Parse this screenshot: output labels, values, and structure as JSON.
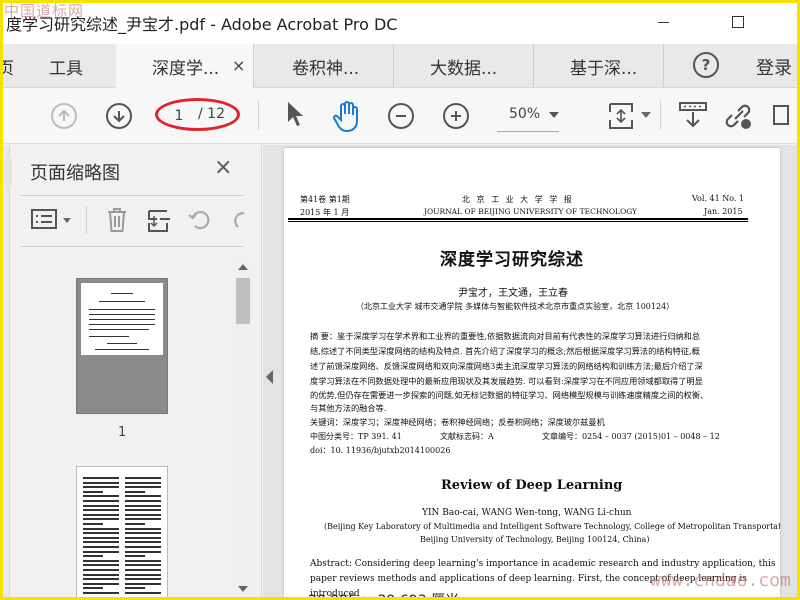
{
  "window": {
    "title": "度学习研究综述_尹宝才.pdf - Adobe Acrobat Pro DC",
    "watermark_top": "中国道标网",
    "watermark_bottom": "www.cndao.com"
  },
  "tabs": {
    "home": "页",
    "tools": "工具",
    "doc1": "深度学...",
    "doc2": "卷积神...",
    "doc3": "大数据...",
    "doc4": "基于深...",
    "close_glyph": "×",
    "help": "?",
    "login": "登录"
  },
  "toolbar": {
    "page_current": "1",
    "page_total": "/ 12",
    "zoom": "50%"
  },
  "panel": {
    "title": "页面缩略图",
    "close_glyph": "×",
    "thumb1_label": "1"
  },
  "pdf": {
    "hdr_left1": "第41卷 第1期",
    "hdr_left2": "2015 年 1 月",
    "hdr_center1": "北 京 工 业 大 学 学 报",
    "hdr_center2": "JOURNAL OF BEIJING UNIVERSITY OF TECHNOLOGY",
    "hdr_right1": "Vol. 41  No. 1",
    "hdr_right2": "Jan.  2015",
    "title_cn": "深度学习研究综述",
    "authors_cn": "尹宝才，王文通，王立春",
    "affil_cn": "（北京工业大学 城市交通学院 多媒体与智能软件技术北京市重点实验室，北京  100124）",
    "abstract_cn": [
      "摘    要：鉴于深度学习在学术界和工业界的重要性,依据数据流向对目前有代表性的深度学习算法进行归纳和总",
      "结,综述了不同类型深度网络的结构及特点. 首先介绍了深度学习的概念;然后根据深度学习算法的结构特征,概",
      "述了前馈深度网络、反馈深度网络和双向深度网络3类主流深度学习算法的网络结构和训练方法;最后介绍了深",
      "度学习算法在不同数据处理中的最新应用现状及其发展趋势. 可以看到:深度学习在不同应用领域都取得了明显",
      "的优势,但仍存在需要进一步探索的问题,如无标记数据的特征学习、网络模型规模与训练速度精度之间的权衡、",
      "与其他方法的融合等."
    ],
    "keywords_cn": "关键词：深度学习；深度神经网络；卷积神经网络；反卷积网络；深度玻尔兹曼机",
    "clc_cn": "中图分类号：TP 391. 41",
    "doc_kind_cn": "文献标志码：A",
    "article_no_cn": "文章编号：0254 – 0037 (2015)01 – 0048 – 12",
    "doi_cn": "doi：10. 11936/bjutxb2014100026",
    "title_en": "Review of Deep Learning",
    "authors_en": "YIN Bao-cai, WANG Wen-tong, WANG Li-chun",
    "affil_en1": "(Beijing Key Laboratory of Multimedia and Intelligent Software Technology, College of Metropolitan Transportation,",
    "affil_en2": "Beijing University of Technology, Beijing 100124, China)",
    "abs_en1": "Abstract: Considering deep learning's importance in academic research and industry application, this",
    "abs_en2": "paper reviews methods and applications of deep learning.  First,  the concept of deep learning is",
    "abs_en3": "introduced"
  },
  "status": {
    "page_size": "20.995 × 29.693 厘米"
  }
}
